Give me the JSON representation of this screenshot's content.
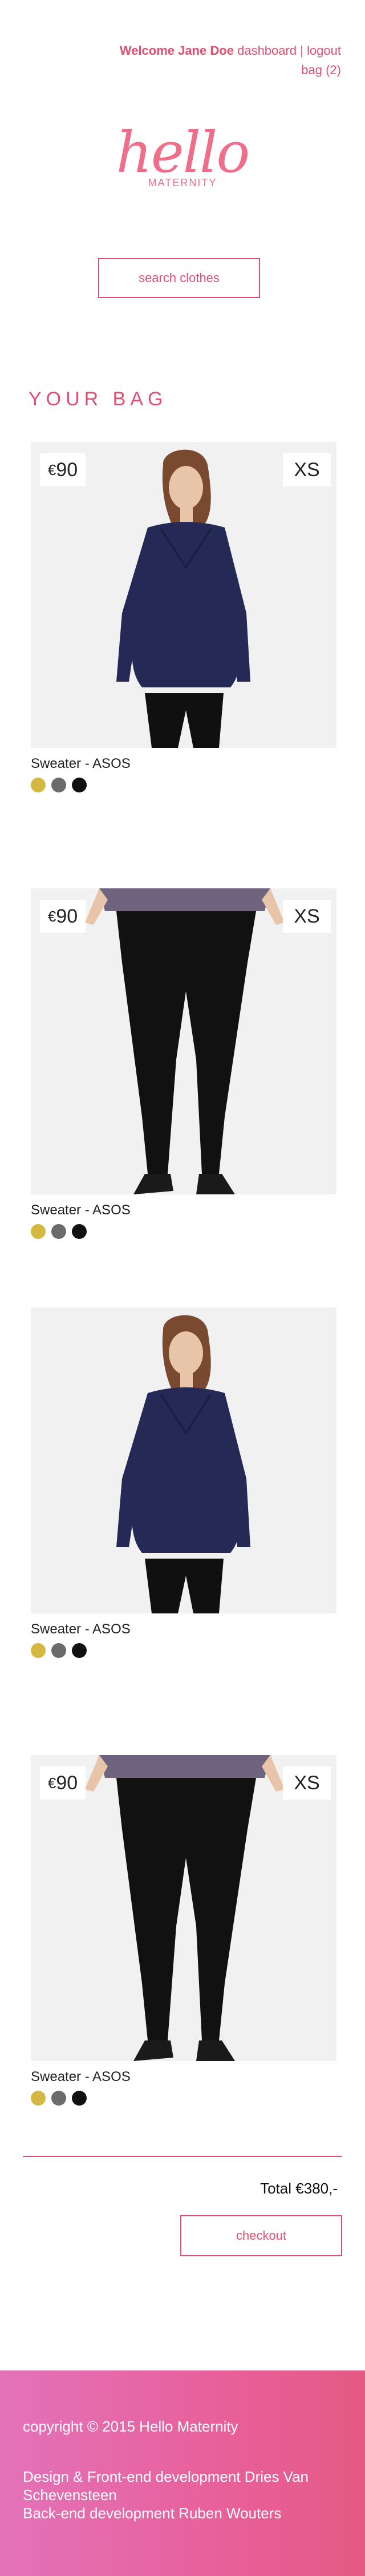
{
  "header": {
    "welcome": "Welcome Jane Doe",
    "dashboard": "dashboard",
    "separator": "|",
    "logout": "logout",
    "bag": "bag (2)"
  },
  "logo": {
    "script": "hello",
    "sub": "MATERNITY"
  },
  "search_label": "search clothes",
  "bag_title": "YOUR BAG",
  "products": [
    {
      "currency": "€",
      "price": "90",
      "size": "XS",
      "name": "Sweater - ASOS",
      "image": "sweater-photo",
      "swatches": [
        "#d4b842",
        "#6b6b6b",
        "#111111"
      ]
    },
    {
      "currency": "€",
      "price": "90",
      "size": "XS",
      "name": "Sweater - ASOS",
      "image": "leggings-photo",
      "swatches": [
        "#d4b842",
        "#6b6b6b",
        "#111111"
      ]
    },
    {
      "currency": "",
      "price": "",
      "size": "",
      "name": "Sweater - ASOS",
      "image": "sweater-photo",
      "swatches": [
        "#d4b842",
        "#6b6b6b",
        "#111111"
      ]
    },
    {
      "currency": "€",
      "price": "90",
      "size": "XS",
      "name": "Sweater - ASOS",
      "image": "leggings-photo",
      "swatches": [
        "#d4b842",
        "#6b6b6b",
        "#111111"
      ]
    }
  ],
  "total": "Total €380,-",
  "checkout_label": "checkout",
  "footer": {
    "copyright": "copyright © 2015 Hello Maternity",
    "credits1": "Design & Front-end development Dries Van Schevensteen",
    "credits2": "Back-end development Ruben Wouters"
  },
  "colors": {
    "accent": "#e24e71",
    "footer_start": "#e372b9",
    "footer_end": "#e45a84"
  }
}
